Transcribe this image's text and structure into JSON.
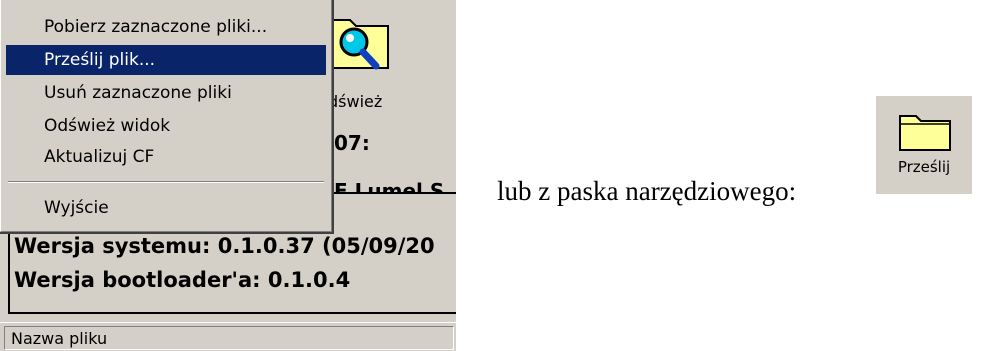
{
  "menu": {
    "items": [
      {
        "label": "Pobierz zaznaczone pliki..."
      },
      {
        "label": "Prześlij plik...",
        "selected": true
      },
      {
        "label": "Usuń zaznaczone pliki"
      },
      {
        "label": "Odśwież widok"
      },
      {
        "label": "Aktualizuj CF"
      },
      {
        "label": "Wyjście"
      }
    ]
  },
  "toolbar_bg": {
    "refresh_label": "dśwież",
    "fragment_07": "07:",
    "fragment_lumel": "E Lumel S"
  },
  "info": {
    "system_version": "Wersja systemu: 0.1.0.37 (05/09/20",
    "bootloader_version": "Wersja bootloader'a: 0.1.0.4"
  },
  "status_bar": {
    "field_label": "Nazwa pliku"
  },
  "caption": "lub z paska narzędziowego:",
  "upload_button": {
    "label": "Prześlij"
  },
  "colors": {
    "window_bg": "#d4d0c8",
    "selection_bg": "#0a246a",
    "folder_yellow": "#ffff99"
  }
}
